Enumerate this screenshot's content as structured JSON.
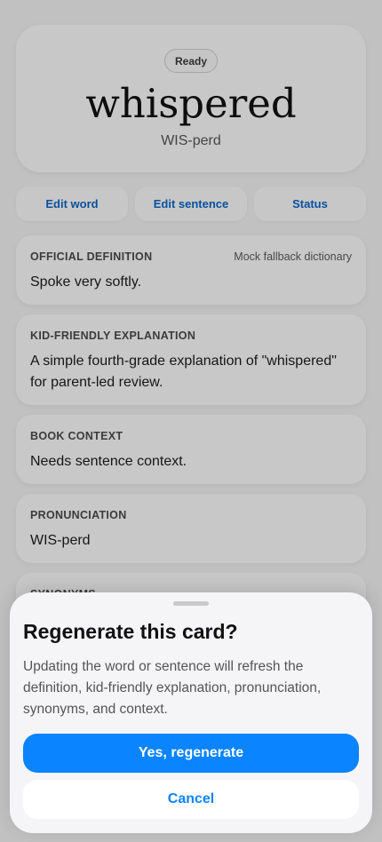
{
  "hero": {
    "status_badge": "Ready",
    "word": "whispered",
    "pronunciation": "WIS-perd"
  },
  "actions": {
    "edit_word": "Edit word",
    "edit_sentence": "Edit sentence",
    "status": "Status"
  },
  "cards": {
    "official_definition": {
      "label": "OFFICIAL DEFINITION",
      "source": "Mock fallback dictionary",
      "text": "Spoke very softly."
    },
    "kid_friendly": {
      "label": "KID-FRIENDLY EXPLANATION",
      "text": "A simple fourth-grade explanation of \"whispered\" for parent-led review."
    },
    "book_context": {
      "label": "BOOK CONTEXT",
      "text": "Needs sentence context."
    },
    "pronunciation": {
      "label": "PRONUNCIATION",
      "text": "WIS-perd"
    },
    "synonyms": {
      "label": "SYNONYMS"
    }
  },
  "sheet": {
    "title": "Regenerate this card?",
    "body": "Updating the word or sentence will refresh the definition, kid-friendly explanation, pronunciation, synonyms, and context.",
    "confirm_label": "Yes, regenerate",
    "cancel_label": "Cancel"
  },
  "colors": {
    "accent": "#0a84ff",
    "link": "#0a66c8",
    "overlay": "rgba(0,0,0,0.2)"
  }
}
